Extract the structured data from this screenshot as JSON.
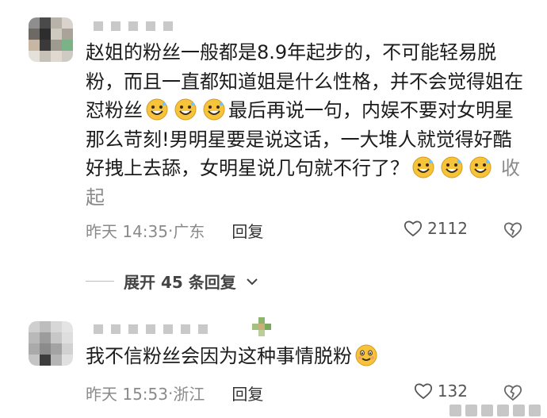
{
  "comments": [
    {
      "text_1": "赵姐的粉丝一般都是8.9年起步的，不可能轻易脱粉，而且一直都知道姐是什么性格，并不会觉得姐在怼粉丝",
      "text_2": "最后再说一句，内娱不要对女明星那么苛刻!男明星要是说这话，一大堆人就觉得好酷好拽上去舔，女明星说几句就不行了？",
      "collapse_label": "收起",
      "time": "昨天 14:35",
      "location": "广东",
      "reply_label": "回复",
      "likes": "2112",
      "icons": [
        "grinning-sweat-emoji",
        "heart-icon",
        "broken-heart-icon"
      ]
    },
    {
      "text": "我不信粉丝会因为这种事情脱粉",
      "time": "昨天 15:53",
      "location": "浙江",
      "reply_label": "回复",
      "likes": "132",
      "icons": [
        "smiling-emoji",
        "heart-icon",
        "broken-heart-icon"
      ]
    }
  ],
  "expand": {
    "label": "展开 45 条回复"
  },
  "separator": "·",
  "colors": {
    "meta": "#8a8a8a",
    "text": "#1c1c1c",
    "emoji": "#f6c33b"
  }
}
